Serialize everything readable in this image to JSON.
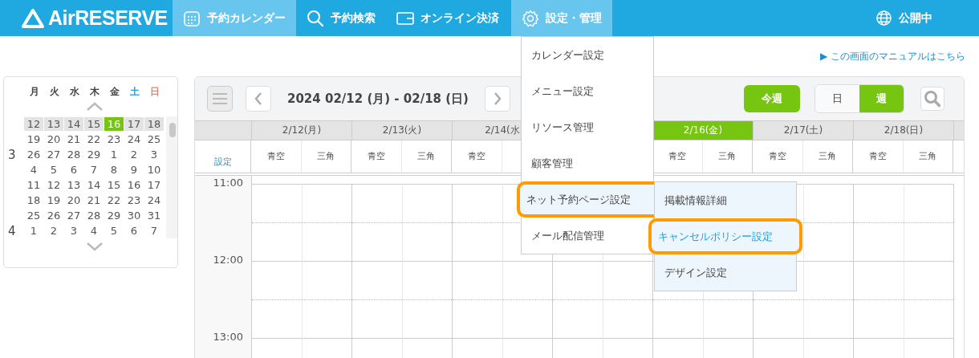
{
  "header": {
    "logo": "AirRESERVE",
    "nav": [
      {
        "label": "予約カレンダー",
        "selected": true
      },
      {
        "label": "予約検索",
        "selected": false
      },
      {
        "label": "オンライン決済",
        "selected": false
      },
      {
        "label": "設定・管理",
        "selected": true
      }
    ],
    "status": "公開中"
  },
  "manual_link": "▶ この画面のマニュアルはこちら",
  "mini_calendar": {
    "weekdays": [
      {
        "label": "月",
        "kind": "weekday"
      },
      {
        "label": "火",
        "kind": "weekday"
      },
      {
        "label": "水",
        "kind": "weekday"
      },
      {
        "label": "木",
        "kind": "weekday"
      },
      {
        "label": "金",
        "kind": "weekday"
      },
      {
        "label": "土",
        "kind": "saturday"
      },
      {
        "label": "日",
        "kind": "sunday"
      }
    ],
    "weeks": [
      {
        "current": true,
        "days": [
          {
            "label": "12",
            "selected": false
          },
          {
            "label": "13",
            "selected": false
          },
          {
            "label": "14",
            "selected": false
          },
          {
            "label": "15",
            "selected": false
          },
          {
            "label": "16",
            "selected": true
          },
          {
            "label": "17",
            "selected": false
          },
          {
            "label": "18",
            "selected": false
          }
        ]
      },
      {
        "current": false,
        "days": [
          {
            "label": "19",
            "selected": false
          },
          {
            "label": "20",
            "selected": false
          },
          {
            "label": "21",
            "selected": false
          },
          {
            "label": "22",
            "selected": false
          },
          {
            "label": "23",
            "selected": false
          },
          {
            "label": "24",
            "selected": false
          },
          {
            "label": "25",
            "selected": false
          }
        ]
      },
      {
        "current": false,
        "month": "3",
        "days": [
          {
            "label": "26",
            "selected": false
          },
          {
            "label": "27",
            "selected": false
          },
          {
            "label": "28",
            "selected": false
          },
          {
            "label": "29",
            "selected": false
          },
          {
            "label": "1",
            "selected": false
          },
          {
            "label": "2",
            "selected": false
          },
          {
            "label": "3",
            "selected": false
          }
        ]
      },
      {
        "current": false,
        "days": [
          {
            "label": "4",
            "selected": false
          },
          {
            "label": "5",
            "selected": false
          },
          {
            "label": "6",
            "selected": false
          },
          {
            "label": "7",
            "selected": false
          },
          {
            "label": "8",
            "selected": false
          },
          {
            "label": "9",
            "selected": false
          },
          {
            "label": "10",
            "selected": false
          }
        ]
      },
      {
        "current": false,
        "days": [
          {
            "label": "11",
            "selected": false
          },
          {
            "label": "12",
            "selected": false
          },
          {
            "label": "13",
            "selected": false
          },
          {
            "label": "14",
            "selected": false
          },
          {
            "label": "15",
            "selected": false
          },
          {
            "label": "16",
            "selected": false
          },
          {
            "label": "17",
            "selected": false
          }
        ]
      },
      {
        "current": false,
        "days": [
          {
            "label": "18",
            "selected": false
          },
          {
            "label": "19",
            "selected": false
          },
          {
            "label": "20",
            "selected": false
          },
          {
            "label": "21",
            "selected": false
          },
          {
            "label": "22",
            "selected": false
          },
          {
            "label": "23",
            "selected": false
          },
          {
            "label": "24",
            "selected": false
          }
        ]
      },
      {
        "current": false,
        "days": [
          {
            "label": "25",
            "selected": false
          },
          {
            "label": "26",
            "selected": false
          },
          {
            "label": "27",
            "selected": false
          },
          {
            "label": "28",
            "selected": false
          },
          {
            "label": "29",
            "selected": false
          },
          {
            "label": "30",
            "selected": false
          },
          {
            "label": "31",
            "selected": false
          }
        ]
      },
      {
        "current": false,
        "month": "4",
        "days": [
          {
            "label": "1",
            "selected": false
          },
          {
            "label": "2",
            "selected": false
          },
          {
            "label": "3",
            "selected": false
          },
          {
            "label": "4",
            "selected": false
          },
          {
            "label": "5",
            "selected": false
          },
          {
            "label": "6",
            "selected": false
          },
          {
            "label": "7",
            "selected": false
          }
        ]
      }
    ]
  },
  "calendar": {
    "date_range": "2024 02/12 (月) - 02/18 (日)",
    "this_week_button": "今週",
    "views": [
      {
        "label": "日",
        "selected": false
      },
      {
        "label": "週",
        "selected": true
      }
    ],
    "settings_link": "設定",
    "days": [
      {
        "date": "2/12(月)",
        "selected": false,
        "resources": [
          "青空",
          "三角"
        ]
      },
      {
        "date": "2/13(火)",
        "selected": false,
        "resources": [
          "青空",
          "三角"
        ]
      },
      {
        "date": "2/14(水",
        "selected": false,
        "resources": [
          "青空"
        ]
      },
      {
        "date": "2/16(金)",
        "selected": true,
        "resources": [
          "青空",
          "三角"
        ]
      },
      {
        "date": "2/17(土)",
        "selected": false,
        "resources": [
          "青空",
          "三角"
        ]
      },
      {
        "date": "2/18(日)",
        "selected": false,
        "resources": [
          "青空",
          "三角"
        ]
      }
    ],
    "times": [
      "11:00",
      "12:00",
      "13:00"
    ]
  },
  "settings_menu": {
    "items": [
      {
        "label": "カレンダー設定",
        "selected": false,
        "highlighted": false
      },
      {
        "label": "メニュー設定",
        "selected": false,
        "highlighted": false
      },
      {
        "label": "リソース管理",
        "selected": false,
        "highlighted": false
      },
      {
        "label": "顧客管理",
        "selected": false,
        "highlighted": false
      },
      {
        "label": "ネット予約ページ設定",
        "selected": true,
        "highlighted": true
      },
      {
        "label": "メール配信管理",
        "selected": false,
        "highlighted": false
      }
    ],
    "submenu": [
      {
        "label": "掲載情報詳細",
        "selected": false,
        "highlighted": false
      },
      {
        "label": "キャンセルポリシー設定",
        "selected": true,
        "highlighted": true
      },
      {
        "label": "デザイン設定",
        "selected": false,
        "highlighted": false
      }
    ]
  }
}
